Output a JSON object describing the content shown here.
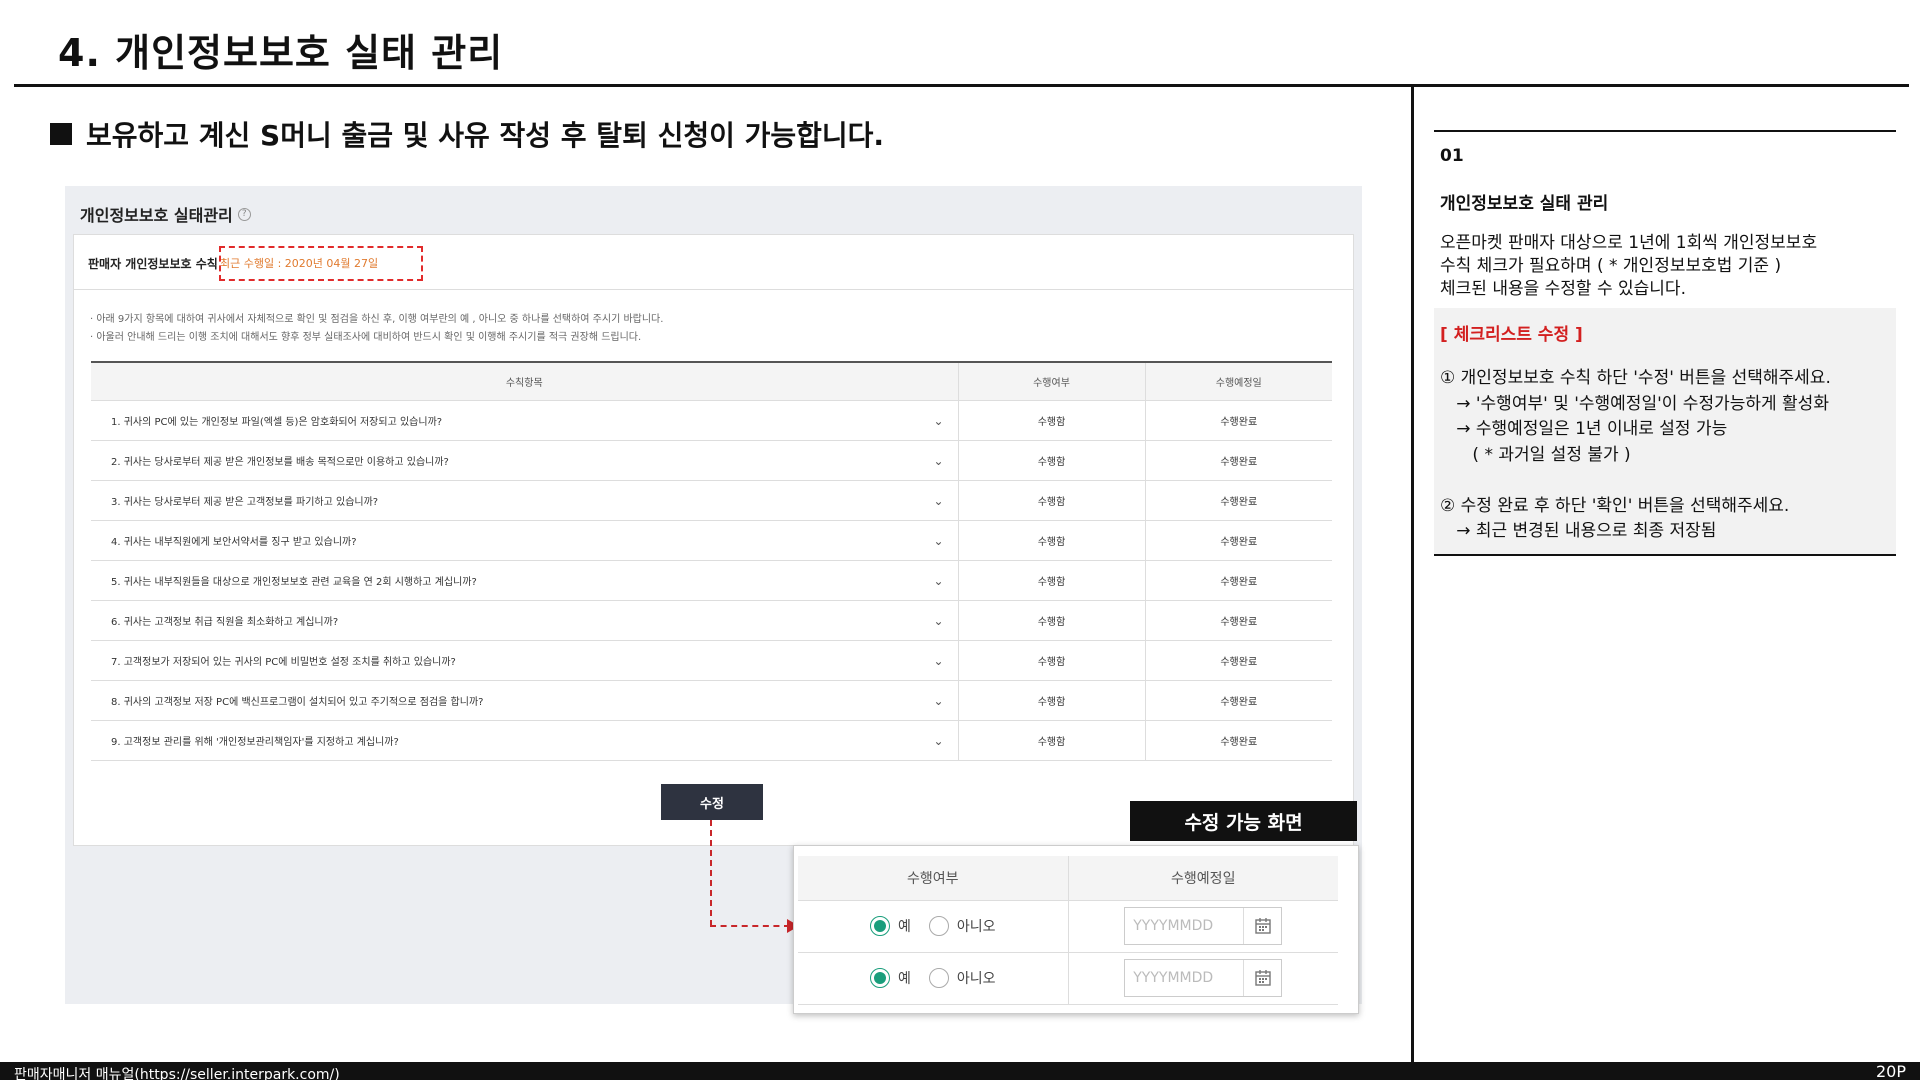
{
  "page": {
    "title": "4. 개인정보보호 실태 관리",
    "section_heading": "보유하고 계신 S머니 출금 및 사유 작성 후 탈퇴 신청이 가능합니다."
  },
  "screenshot": {
    "title": "개인정보보호 실태관리",
    "help_glyph": "?",
    "compliance_label": "판매자 개인정보보호 수칙",
    "recent_date": "최근 수행일 : 2020년 04월 27일",
    "notes": [
      "· 아래 9가지 항목에 대하여 귀사에서 자체적으로 확인 및 점검을 하신 후, 이행 여부란의 예 , 아니오 중 하나를 선택하여 주시기 바랍니다.",
      "· 아울러 안내해 드리는 이행 조치에 대해서도 향후 정부 실태조사에 대비하여 반드시 확인 및 이행해 주시기를 적극 권장해 드립니다."
    ],
    "table_headers": [
      "수칙항목",
      "수행여부",
      "수행예정일"
    ],
    "rows": [
      {
        "q": "1. 귀사의 PC에 있는 개인정보 파일(엑셀 등)은 암호화되어 저장되고 있습니까?",
        "status": "수행함",
        "plan": "수행완료"
      },
      {
        "q": "2. 귀사는 당사로부터 제공 받은 개인정보를 배송 목적으로만 이용하고 있습니까?",
        "status": "수행함",
        "plan": "수행완료"
      },
      {
        "q": "3. 귀사는 당사로부터 제공 받은 고객정보를 파기하고 있습니까?",
        "status": "수행함",
        "plan": "수행완료"
      },
      {
        "q": "4. 귀사는 내부직원에게 보안서약서를 징구 받고 있습니까?",
        "status": "수행함",
        "plan": "수행완료"
      },
      {
        "q": "5. 귀사는 내부직원들을 대상으로 개인정보보호 관련 교육을 연 2회 시행하고 계십니까?",
        "status": "수행함",
        "plan": "수행완료"
      },
      {
        "q": "6. 귀사는 고객정보 취급 직원을 최소화하고 계십니까?",
        "status": "수행함",
        "plan": "수행완료"
      },
      {
        "q": "7. 고객정보가 저장되어 있는 귀사의 PC에 비밀번호 설정 조치를 취하고 있습니까?",
        "status": "수행함",
        "plan": "수행완료"
      },
      {
        "q": "8. 귀사의 고객정보 저장 PC에 백신프로그램이 설치되어 있고 주기적으로 점검을 합니까?",
        "status": "수행함",
        "plan": "수행완료"
      },
      {
        "q": "9. 고객정보 관리를 위해 '개인정보관리책임자'를 지정하고 계십니까?",
        "status": "수행함",
        "plan": "수행완료"
      }
    ],
    "edit_button": "수정"
  },
  "popup": {
    "badge": "수정 가능 화면",
    "headers": [
      "수행여부",
      "수행예정일"
    ],
    "yes_label": "예",
    "no_label": "아니오",
    "date_placeholder": "YYYYMMDD",
    "rows": [
      {
        "selected": "yes"
      },
      {
        "selected": "yes"
      }
    ]
  },
  "right_panel": {
    "number": "01",
    "title": "개인정보보호 실태 관리",
    "description": "오픈마켓 판매자 대상으로 1년에 1회씩 개인정보보호\n수칙 체크가 필요하며 ( * 개인정보보호법 기준 )\n체크된 내용을 수정할 수 있습니다.",
    "box_title": "[ 체크리스트 수정 ]",
    "steps": "① 개인정보보호 수칙 하단 '수정' 버튼을 선택해주세요.\n   → '수행여부' 및 '수행예정일'이 수정가능하게 활성화\n   → 수행예정일은 1년 이내로 설정 가능\n      ( * 과거일 설정 불가 )\n\n② 수정 완료 후 하단 '확인' 버튼을 선택해주세요.\n   → 최근 변경된 내용으로 최종 저장됨"
  },
  "footer": {
    "url": "판매자매니저 매뉴얼(https://seller.interpark.com/)",
    "page": "20P"
  },
  "colors": {
    "accent_red": "#d32020",
    "radio_green": "#1a9e7c",
    "button_dark": "#2e3340",
    "date_orange": "#e07a2e"
  }
}
